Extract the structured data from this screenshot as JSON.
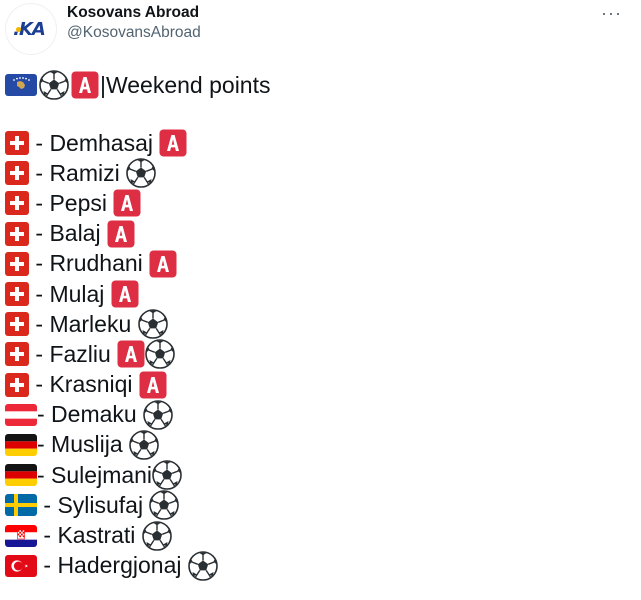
{
  "header": {
    "avatar_text": ".KA",
    "display_name": "Kosovans Abroad",
    "handle": "@KosovansAbroad",
    "more_label": "···"
  },
  "tweet": {
    "title_prefix_icons": [
      "kosovo-flag-icon",
      "soccer-ball-icon",
      "a-button-icon"
    ],
    "title": "|Weekend points",
    "rows": [
      {
        "flag": "switzerland",
        "text": " - Demhasaj ",
        "suffix": [
          "a-button"
        ]
      },
      {
        "flag": "switzerland",
        "text": " - Ramizi ",
        "suffix": [
          "soccer-ball"
        ]
      },
      {
        "flag": "switzerland",
        "text": " - Pepsi ",
        "suffix": [
          "a-button"
        ]
      },
      {
        "flag": "switzerland",
        "text": " - Balaj ",
        "suffix": [
          "a-button"
        ]
      },
      {
        "flag": "switzerland",
        "text": " - Rrudhani ",
        "suffix": [
          "a-button"
        ]
      },
      {
        "flag": "switzerland",
        "text": " - Mulaj ",
        "suffix": [
          "a-button"
        ]
      },
      {
        "flag": "switzerland",
        "text": " - Marleku ",
        "suffix": [
          "soccer-ball"
        ]
      },
      {
        "flag": "switzerland",
        "text": " - Fazliu ",
        "suffix": [
          "a-button",
          "soccer-ball"
        ]
      },
      {
        "flag": "switzerland",
        "text": " - Krasniqi ",
        "suffix": [
          "a-button"
        ]
      },
      {
        "flag": "austria",
        "text": "- Demaku ",
        "suffix": [
          "soccer-ball"
        ]
      },
      {
        "flag": "germany",
        "text": "- Muslija ",
        "suffix": [
          "soccer-ball"
        ]
      },
      {
        "flag": "germany",
        "text": "- Sulejmani",
        "suffix": [
          "soccer-ball"
        ]
      },
      {
        "flag": "sweden",
        "text": " - Sylisufaj ",
        "suffix": [
          "soccer-ball"
        ]
      },
      {
        "flag": "croatia",
        "text": " - Kastrati ",
        "suffix": [
          "soccer-ball"
        ]
      },
      {
        "flag": "turkey",
        "text": " - Hadergjonaj ",
        "suffix": [
          "soccer-ball"
        ]
      }
    ]
  },
  "colors": {
    "text": "#0f1419",
    "secondary": "#536471",
    "swiss_red": "#da291c",
    "a_button_red": "#dd2e44",
    "kosovo_blue": "#244aa5",
    "kosovo_gold": "#d0a650"
  }
}
